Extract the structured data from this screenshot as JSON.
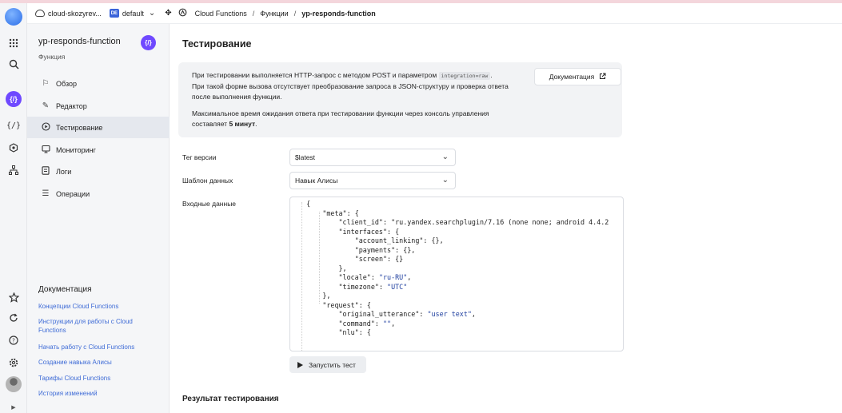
{
  "topbar": {
    "cloud": "cloud-skozyrev...",
    "folder_badge": "DE",
    "folder": "default",
    "breadcrumbs": [
      "Cloud Functions",
      "Функции",
      "yp-responds-function"
    ]
  },
  "sidebar": {
    "title": "yp-responds-function",
    "subtitle": "Функция",
    "badge": "{/}",
    "nav": [
      {
        "label": "Обзор",
        "icon": "flag-icon"
      },
      {
        "label": "Редактор",
        "icon": "edit-icon"
      },
      {
        "label": "Тестирование",
        "icon": "play-circle-icon"
      },
      {
        "label": "Мониторинг",
        "icon": "monitor-icon"
      },
      {
        "label": "Логи",
        "icon": "log-icon"
      },
      {
        "label": "Операции",
        "icon": "list-icon"
      }
    ],
    "active_index": 2,
    "docs_title": "Документация",
    "doc_links": [
      "Концепции Cloud Functions",
      "Инструкции для работы с Cloud Functions",
      "Начать работу с Cloud Functions",
      "Создание навыка Алисы",
      "Тарифы Cloud Functions",
      "История изменений"
    ]
  },
  "rail": {
    "items": [
      "apps-grid-icon",
      "search-icon",
      "functions-icon",
      "code-icon",
      "settings-gear-icon",
      "hierarchy-icon",
      "star-icon",
      "refresh-icon",
      "help-icon",
      "settings-icon",
      "avatar-icon",
      "expand-icon"
    ]
  },
  "main": {
    "title": "Тестирование",
    "info": {
      "line1_pre": "При тестировании выполняется HTTP-запрос с методом POST и параметром ",
      "line1_code": "integration=raw",
      "line1_post": ".",
      "line2": "При такой форме вызова отсутствует преобразование запроса в JSON-структуру и проверка ответа после выполнения функции.",
      "line3_pre": "Максимальное время ожидания ответа при тестировании функции через консоль управления составляет ",
      "line3_bold": "5 минут",
      "line3_post": ".",
      "doc_button": "Документация"
    },
    "version_label": "Тег версии",
    "version_value": "$latest",
    "template_label": "Шаблон данных",
    "template_value": "Навык Алисы",
    "input_label": "Входные данные",
    "code_lines": [
      "{",
      "    \"meta\": {",
      "        \"client_id\": \"ru.yandex.searchplugin/7.16 (none none; android 4.4.2",
      "        \"interfaces\": {",
      "            \"account_linking\": {},",
      "            \"payments\": {},",
      "            \"screen\": {}",
      "        },",
      "        \"locale\": \"ru-RU\",",
      "        \"timezone\": \"UTC\"",
      "    },",
      "    \"request\": {",
      "        \"original_utterance\": \"user text\",",
      "        \"command\": \"\",",
      "        \"nlu\": {"
    ],
    "run_button": "Запустить тест",
    "result_title": "Результат тестирования"
  },
  "colors": {
    "accent": "#6f49ff",
    "link": "#3e6bd6",
    "folder_badge": "#3a63d9"
  }
}
